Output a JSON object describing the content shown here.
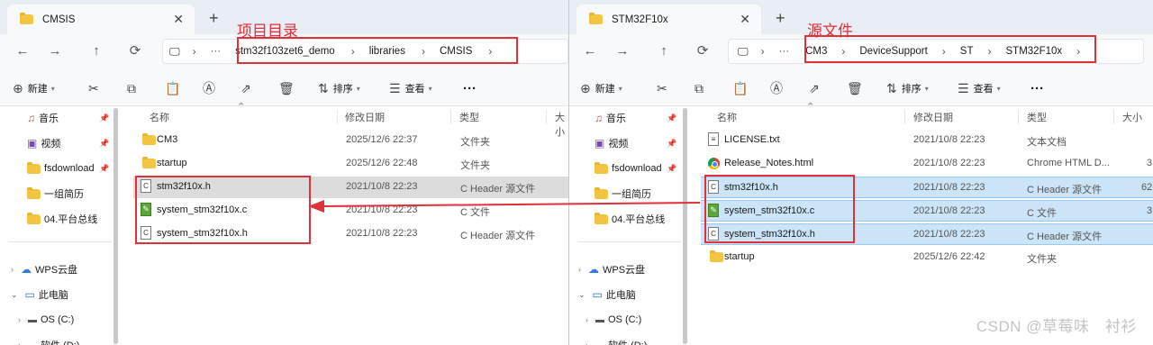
{
  "colors": {
    "red": "#e0303a",
    "selection": "#cce4f7",
    "folder": "#f4c542"
  },
  "left": {
    "tab_title": "CMSIS",
    "annotation": "项目目录",
    "breadcrumbs": [
      "stm32f103zet6_demo",
      "libraries",
      "CMSIS"
    ],
    "toolbar": {
      "new": "新建",
      "sort": "排序",
      "view": "查看",
      "more": "···"
    },
    "nav": [
      {
        "label": "音乐",
        "icon": "music-icon"
      },
      {
        "label": "视频",
        "icon": "video-icon"
      },
      {
        "label": "fsdownload",
        "icon": "folder-icon"
      },
      {
        "label": "一组简历",
        "icon": "folder-icon"
      },
      {
        "label": "04.平台总线",
        "icon": "folder-icon"
      },
      {
        "label": "WPS云盘",
        "icon": "cloud-icon"
      },
      {
        "label": "此电脑",
        "icon": "pc-icon"
      },
      {
        "label": "OS (C:)",
        "icon": "drive-icon"
      },
      {
        "label": "软件 (D:)",
        "icon": "drive-icon"
      }
    ],
    "columns": {
      "name": "名称",
      "modified": "修改日期",
      "type": "类型",
      "size": "大小"
    },
    "files": [
      {
        "name": "CM3",
        "modified": "2025/12/6 22:37",
        "type": "文件夹",
        "kind": "folder"
      },
      {
        "name": "startup",
        "modified": "2025/12/6 22:48",
        "type": "文件夹",
        "kind": "folder"
      },
      {
        "name": "stm32f10x.h",
        "modified": "2021/10/8 22:23",
        "type": "C Header 源文件",
        "kind": "header"
      },
      {
        "name": "system_stm32f10x.c",
        "modified": "2021/10/8 22:23",
        "type": "C 文件",
        "kind": "c"
      },
      {
        "name": "system_stm32f10x.h",
        "modified": "2021/10/8 22:23",
        "type": "C Header 源文件",
        "kind": "header"
      }
    ]
  },
  "right": {
    "tab_title": "STM32F10x",
    "annotation": "源文件",
    "breadcrumbs": [
      "CM3",
      "DeviceSupport",
      "ST",
      "STM32F10x"
    ],
    "toolbar": {
      "new": "新建",
      "sort": "排序",
      "view": "查看",
      "more": "···"
    },
    "nav": [
      {
        "label": "音乐",
        "icon": "music-icon"
      },
      {
        "label": "视频",
        "icon": "video-icon"
      },
      {
        "label": "fsdownload",
        "icon": "folder-icon"
      },
      {
        "label": "一组简历",
        "icon": "folder-icon"
      },
      {
        "label": "04.平台总线",
        "icon": "folder-icon"
      },
      {
        "label": "WPS云盘",
        "icon": "cloud-icon"
      },
      {
        "label": "此电脑",
        "icon": "pc-icon"
      },
      {
        "label": "OS (C:)",
        "icon": "drive-icon"
      },
      {
        "label": "软件 (D:)",
        "icon": "drive-icon"
      }
    ],
    "columns": {
      "name": "名称",
      "modified": "修改日期",
      "type": "类型",
      "size": "大小"
    },
    "files": [
      {
        "name": "LICENSE.txt",
        "modified": "2021/10/8 22:23",
        "type": "文本文档",
        "size": "",
        "kind": "txt"
      },
      {
        "name": "Release_Notes.html",
        "modified": "2021/10/8 22:23",
        "type": "Chrome HTML D...",
        "size": "3",
        "kind": "html"
      },
      {
        "name": "stm32f10x.h",
        "modified": "2021/10/8 22:23",
        "type": "C Header 源文件",
        "size": "62",
        "kind": "header"
      },
      {
        "name": "system_stm32f10x.c",
        "modified": "2021/10/8 22:23",
        "type": "C 文件",
        "size": "3",
        "kind": "c"
      },
      {
        "name": "system_stm32f10x.h",
        "modified": "2021/10/8 22:23",
        "type": "C Header 源文件",
        "size": "",
        "kind": "header"
      },
      {
        "name": "startup",
        "modified": "2025/12/6 22:42",
        "type": "文件夹",
        "size": "",
        "kind": "folder"
      }
    ]
  },
  "watermark": "CSDN @草莓味　衬衫"
}
